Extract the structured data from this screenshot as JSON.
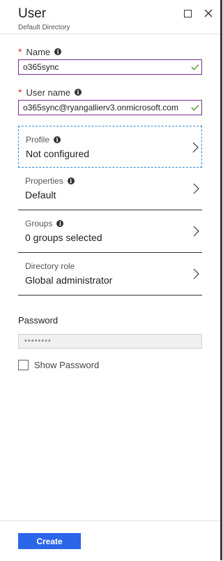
{
  "header": {
    "title": "User",
    "subtitle": "Default Directory"
  },
  "name_field": {
    "required_mark": "*",
    "label": "Name",
    "value": "o365sync"
  },
  "username_field": {
    "required_mark": "*",
    "label": "User name",
    "value": "o365sync@ryangallierv3.onmicrosoft.com"
  },
  "nav_items": [
    {
      "label": "Profile",
      "value": "Not configured",
      "selected": true
    },
    {
      "label": "Properties",
      "value": "Default"
    },
    {
      "label": "Groups",
      "value": "0 groups selected"
    },
    {
      "label": "Directory role",
      "value": "Global administrator"
    }
  ],
  "password": {
    "label": "Password",
    "masked_value": "••••••••",
    "show_label": "Show Password",
    "show_checked": false
  },
  "footer": {
    "create_label": "Create"
  },
  "colors": {
    "accent": "#2b66e8",
    "required": "#d8262c",
    "valid_check": "#5ea23a",
    "input_border": "#7c2a8e"
  }
}
